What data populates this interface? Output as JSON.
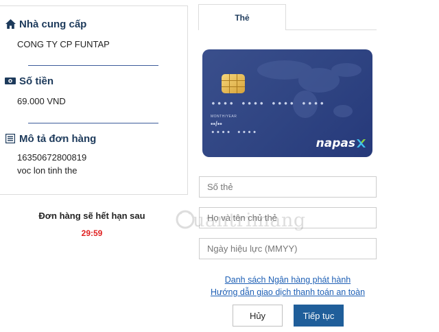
{
  "order_info": {
    "provider": {
      "title": "Nhà cung cấp",
      "value": "CONG TY CP FUNTAP",
      "icon": "home-icon"
    },
    "amount": {
      "title": "Số tiền",
      "value": "69.000 VND",
      "icon": "money-icon"
    },
    "description": {
      "title": "Mô tả đơn hàng",
      "line1": "16350672800819",
      "line2": "voc lon tinh the",
      "icon": "receipt-icon"
    }
  },
  "expiry": {
    "label": "Đơn hàng sẽ hết hạn sau",
    "countdown": "29:59",
    "countdown_color": "#e02020"
  },
  "tabs": [
    {
      "label": "Thẻ",
      "active": true
    }
  ],
  "card": {
    "number_mask": "•••• •••• •••• ••••",
    "month_year_label": "MONTH/YEAR",
    "expiry_mask": "••/••",
    "name_mask": "•••• ••••",
    "brand": "napas",
    "color": "#2f4482"
  },
  "form": {
    "card_number_placeholder": "Số thẻ",
    "holder_name_placeholder": "Họ và tên chủ thẻ",
    "valid_date_placeholder": "Ngày hiệu lực (MMYY)"
  },
  "links": {
    "bank_list": "Danh sách Ngân hàng phát hành",
    "safe_guide": "Hướng dẫn giao dịch thanh toán an toàn"
  },
  "buttons": {
    "cancel": "Hủy",
    "continue": "Tiếp tục",
    "primary_color": "#1f5e9a"
  },
  "watermark": {
    "text": "uantrimang"
  }
}
